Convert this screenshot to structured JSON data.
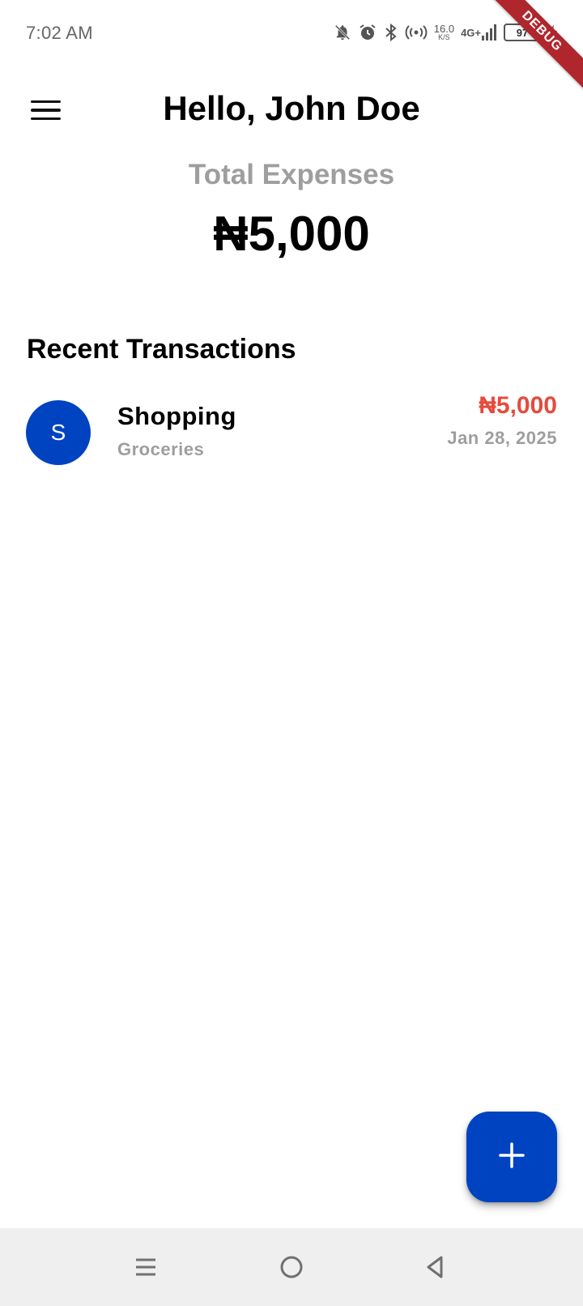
{
  "status_bar": {
    "time": "7:02 AM",
    "net_speed_value": "16.0",
    "net_speed_unit": "K/S",
    "network_type": "4G+",
    "battery_level": "97",
    "icons": [
      "notifications-off-icon",
      "alarm-icon",
      "bluetooth-icon",
      "hotspot-icon",
      "signal-icon",
      "battery-icon",
      "charging-icon"
    ]
  },
  "debug_banner": "DEBUG",
  "app_bar": {
    "greeting": "Hello, John Doe",
    "menu_icon": "menu-icon"
  },
  "summary": {
    "label": "Total Expenses",
    "amount": "₦5,000"
  },
  "recent": {
    "title": "Recent Transactions",
    "transactions": [
      {
        "avatar_letter": "S",
        "title": "Shopping",
        "category": "Groceries",
        "amount": "₦5,000",
        "date": "Jan 28, 2025"
      }
    ]
  },
  "fab": {
    "icon": "plus-icon"
  },
  "nav_bar": {
    "icons": [
      "recents-icon",
      "home-icon",
      "back-icon"
    ]
  },
  "colors": {
    "accent": "#0043c0",
    "expense_red": "#e54b3c",
    "muted_gray": "#9e9e9e",
    "debug_banner": "#b0262d",
    "nav_bg": "#efefef"
  }
}
